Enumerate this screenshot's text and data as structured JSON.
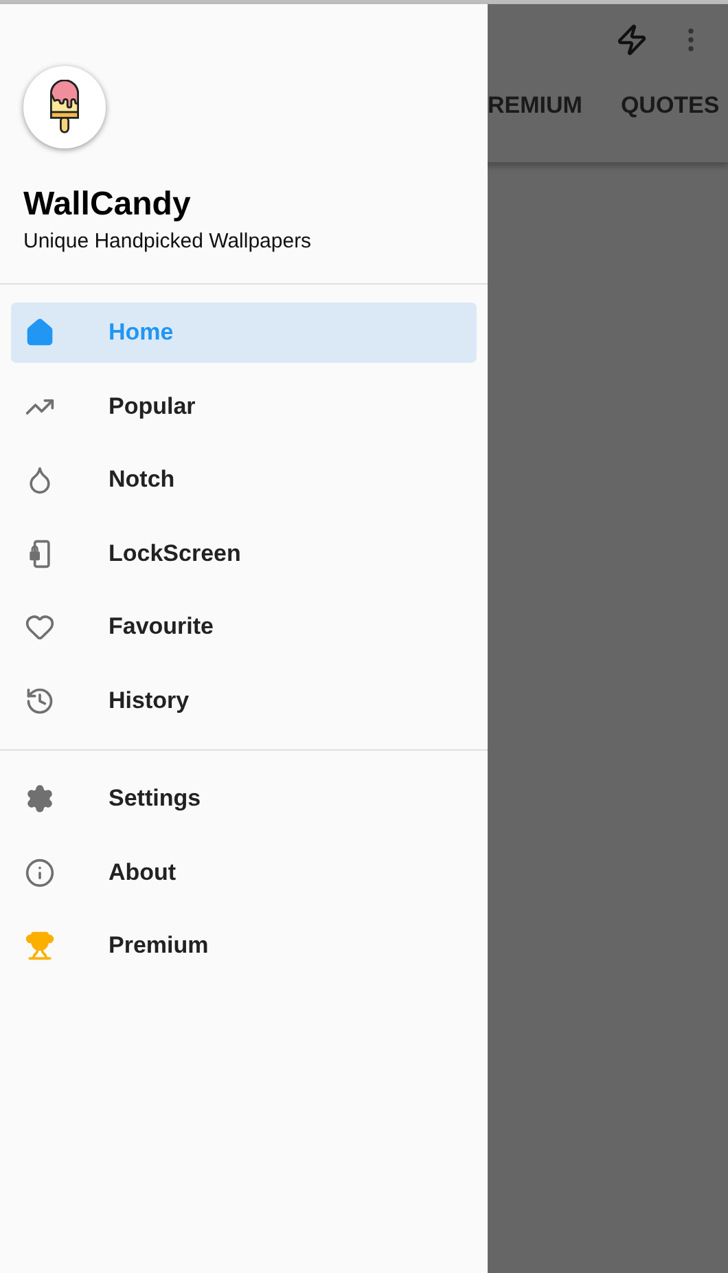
{
  "app_bar": {
    "tabs": [
      {
        "label": "REMIUM"
      },
      {
        "label": "QUOTES"
      }
    ]
  },
  "drawer": {
    "header": {
      "title": "WallCandy",
      "subtitle": "Unique Handpicked Wallpapers"
    },
    "groups": [
      {
        "items": [
          {
            "label": "Home",
            "selected": true
          },
          {
            "label": "Popular",
            "selected": false
          },
          {
            "label": "Notch",
            "selected": false
          },
          {
            "label": "LockScreen",
            "selected": false
          },
          {
            "label": "Favourite",
            "selected": false
          },
          {
            "label": "History",
            "selected": false
          }
        ]
      },
      {
        "items": [
          {
            "label": "Settings",
            "selected": false
          },
          {
            "label": "About",
            "selected": false
          },
          {
            "label": "Premium",
            "selected": false
          }
        ]
      }
    ]
  }
}
